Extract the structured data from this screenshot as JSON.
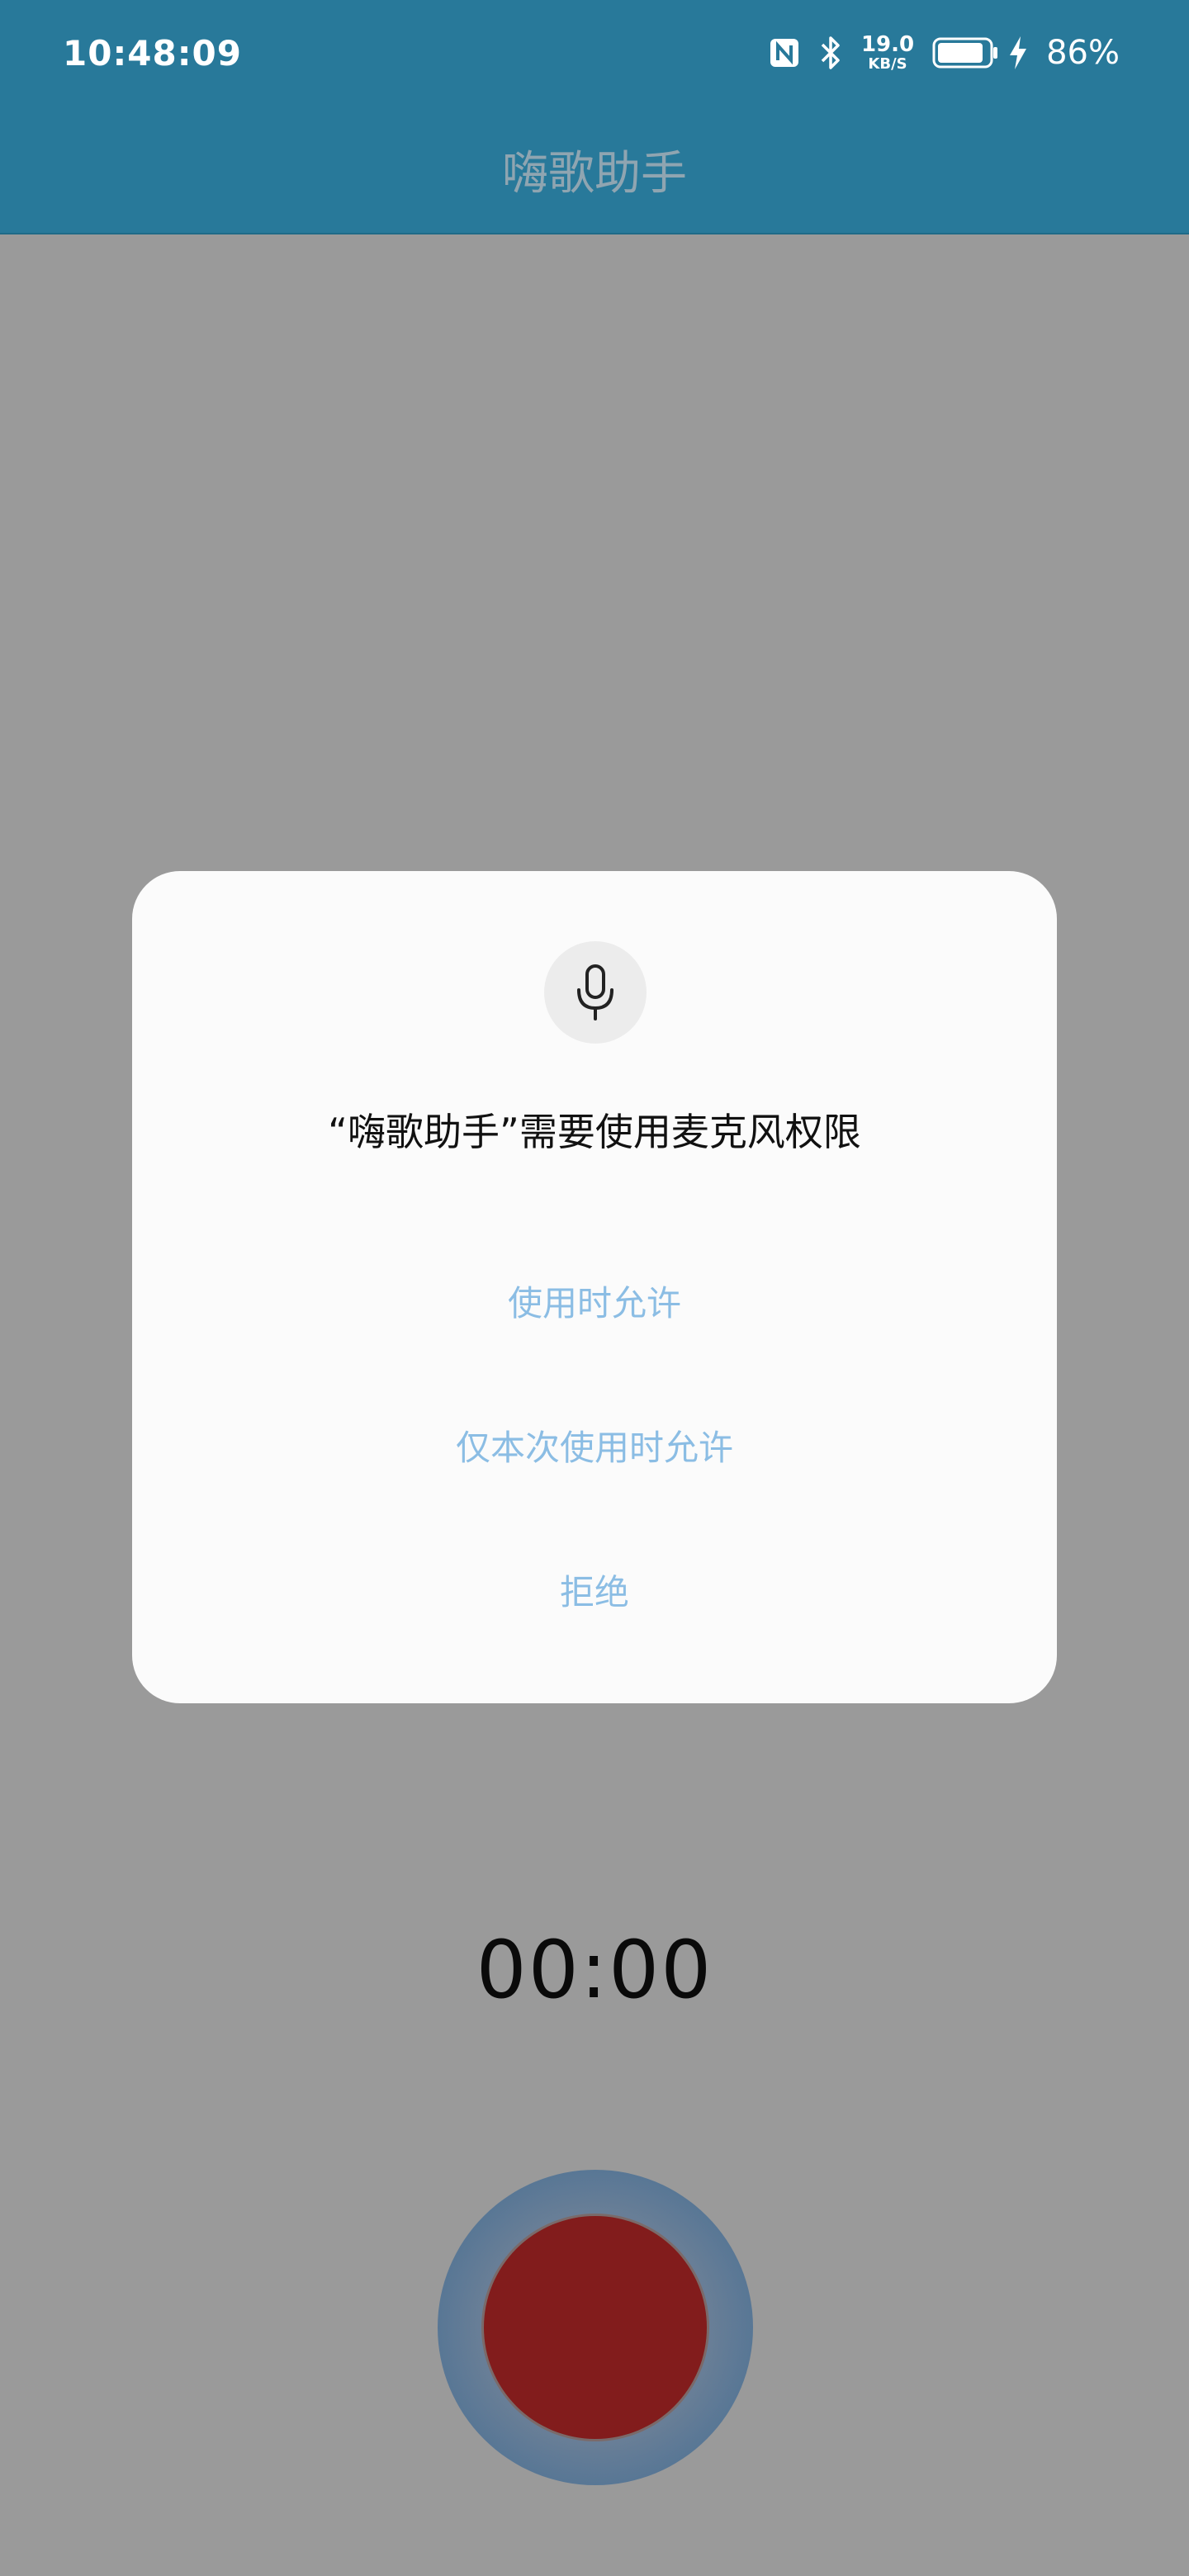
{
  "status_bar": {
    "time": "10:48:09",
    "net_speed_value": "19.0",
    "net_speed_unit": "KB/S",
    "battery_percent": "86%",
    "icons": [
      "nfc-icon",
      "bluetooth-icon",
      "battery-icon",
      "charging-bolt-icon"
    ]
  },
  "app_bar": {
    "title": "嗨歌助手"
  },
  "permission_dialog": {
    "icon": "microphone-icon",
    "title": "“嗨歌助手”需要使用麦克风权限",
    "allow_while_using": "使用时允许",
    "allow_this_time": "仅本次使用时允许",
    "deny": "拒绝"
  },
  "recorder": {
    "timer": "00:00",
    "record_button_color": "#821c1c"
  },
  "colors": {
    "app_bar": "#28799a",
    "dialog_button_text": "#8bbde4",
    "scrim_background": "#9a9a9a"
  }
}
